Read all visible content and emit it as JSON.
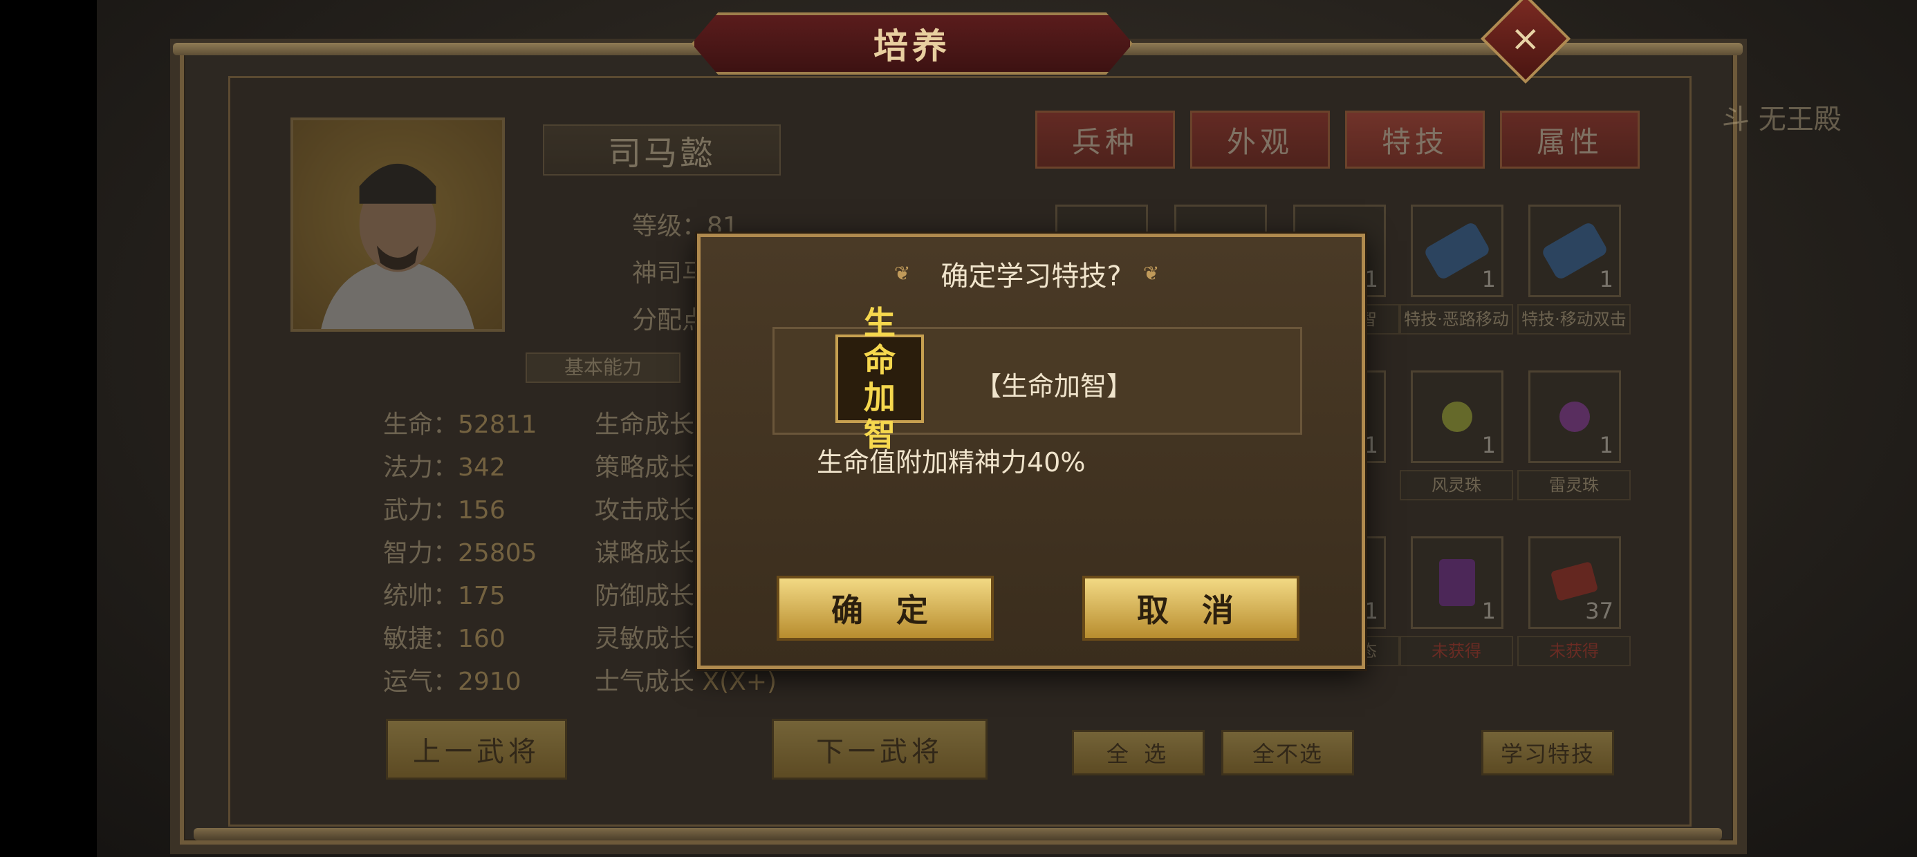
{
  "title": "培养",
  "close_icon": "×",
  "hero": {
    "name": "司马懿",
    "level_label": "等级：",
    "level_value": "81",
    "info_line2": "神司马",
    "info_line3": "分配点",
    "section_label": "基本能力"
  },
  "stats": [
    {
      "label": "生命：",
      "value": "52811"
    },
    {
      "label": "法力：",
      "value": "342"
    },
    {
      "label": "武力：",
      "value": "156"
    },
    {
      "label": "智力：",
      "value": "25805"
    },
    {
      "label": "统帅：",
      "value": "175"
    },
    {
      "label": "敏捷：",
      "value": "160"
    },
    {
      "label": "运气：",
      "value": "2910"
    }
  ],
  "growth": [
    {
      "label": "生命成长",
      "value": ""
    },
    {
      "label": "策略成长",
      "value": ""
    },
    {
      "label": "攻击成长",
      "value": ""
    },
    {
      "label": "谋略成长",
      "value": ""
    },
    {
      "label": "防御成长",
      "value": ""
    },
    {
      "label": "灵敏成长",
      "value": ""
    },
    {
      "label": "士气成长",
      "value": "X(X+)"
    }
  ],
  "nav": {
    "prev": "上一武将",
    "next": "下一武将"
  },
  "tabs": [
    "兵种",
    "外观",
    "特技",
    "属性"
  ],
  "inventory": {
    "row1": [
      {
        "count": "",
        "label": ""
      },
      {
        "count": "",
        "label": ""
      },
      {
        "count": "1",
        "label": "加智"
      },
      {
        "count": "1",
        "label": "特技·恶路移动"
      },
      {
        "count": "1",
        "label": "特技·移动双击"
      }
    ],
    "row2": [
      {
        "count": "1",
        "label": ""
      },
      {
        "count": "1",
        "label": "风灵珠"
      },
      {
        "count": "1",
        "label": "雷灵珠"
      }
    ],
    "row3": [
      {
        "count": "1",
        "label": "状态"
      },
      {
        "count": "1",
        "label": "未获得"
      },
      {
        "count": "37",
        "label": "未获得"
      }
    ]
  },
  "actions": {
    "select_all": "全 选",
    "deselect_all": "全不选",
    "learn": "学习特技"
  },
  "right_edge_text": "斗 无王殿",
  "modal": {
    "title": "确定学习特技?",
    "skill_icon_text": "生命加智",
    "skill_name": "【生命加智】",
    "skill_desc": "生命值附加精神力40%",
    "confirm": "确 定",
    "cancel": "取 消"
  },
  "colors": {
    "gold_button": "#d8b85a",
    "tab_red": "#b1312a",
    "stat_value": "#d8b66e",
    "modal_border": "#b08a4e"
  }
}
